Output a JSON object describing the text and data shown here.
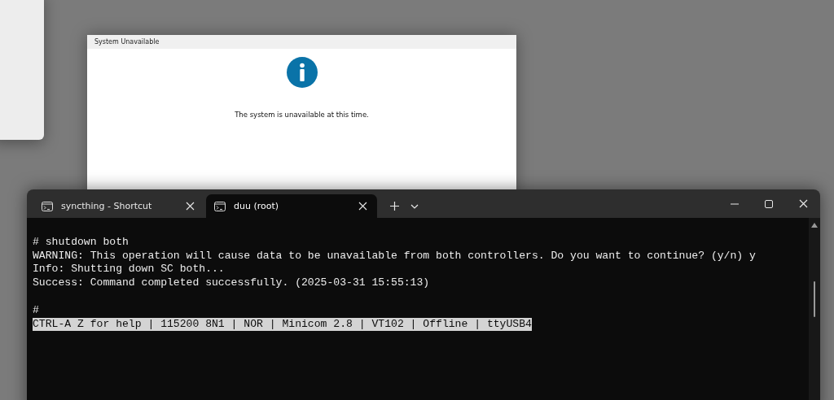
{
  "dialog": {
    "title": "System Unavailable",
    "message": "The system is unavailable at this time."
  },
  "terminal": {
    "tabs": [
      {
        "label": "syncthing - Shortcut",
        "selected": false
      },
      {
        "label": "duu (root)",
        "selected": true
      }
    ],
    "lines": [
      {
        "kind": "gap"
      },
      {
        "kind": "text",
        "text": "# shutdown both"
      },
      {
        "kind": "text",
        "text": "WARNING: This operation will cause data to be unavailable from both controllers. Do you want to continue? (y/n) y"
      },
      {
        "kind": "text",
        "text": "Info: Shutting down SC both..."
      },
      {
        "kind": "text",
        "text": "Success: Command completed successfully. (2025-03-31 15:55:13)"
      },
      {
        "kind": "gap"
      },
      {
        "kind": "text",
        "text": "#"
      },
      {
        "kind": "status",
        "text": "CTRL-A Z for help | 115200 8N1 | NOR | Minicom 2.8 | VT102 | Offline | ttyUSB4"
      }
    ]
  }
}
